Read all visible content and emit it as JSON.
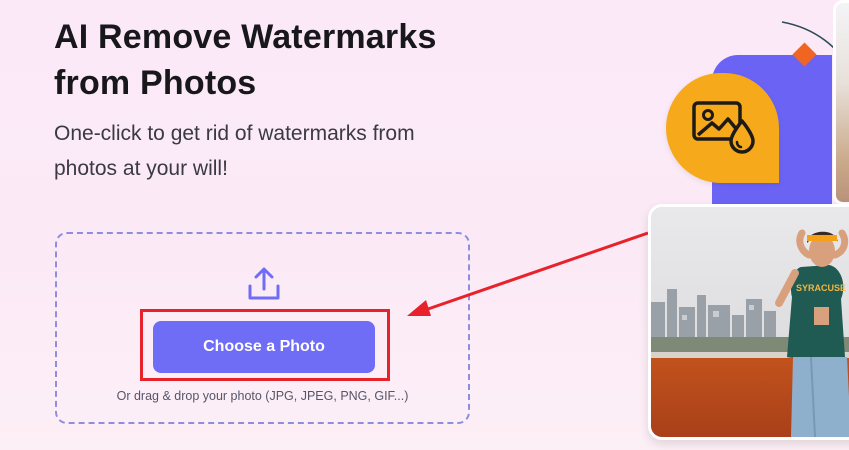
{
  "hero": {
    "title": "AI Remove Watermarks from Photos",
    "subtitle": "One-click to get rid of watermarks from photos at your will!"
  },
  "upload": {
    "button_label": "Choose a Photo",
    "drop_hint": "Or drag & drop your photo (JPG, JPEG, PNG, GIF...)"
  },
  "icons": {
    "upload": "upload-arrow-icon",
    "badge": "image-watermark-drop-icon"
  },
  "colors": {
    "accent": "#6f6cf6",
    "dash_border": "#8d8ee0",
    "annotation_red": "#e8222b",
    "badge_orange": "#f6a91b",
    "card_purple": "#6b63f3",
    "diamond_orange": "#f06522"
  },
  "photo_shirt_text": "SYRACUSE"
}
